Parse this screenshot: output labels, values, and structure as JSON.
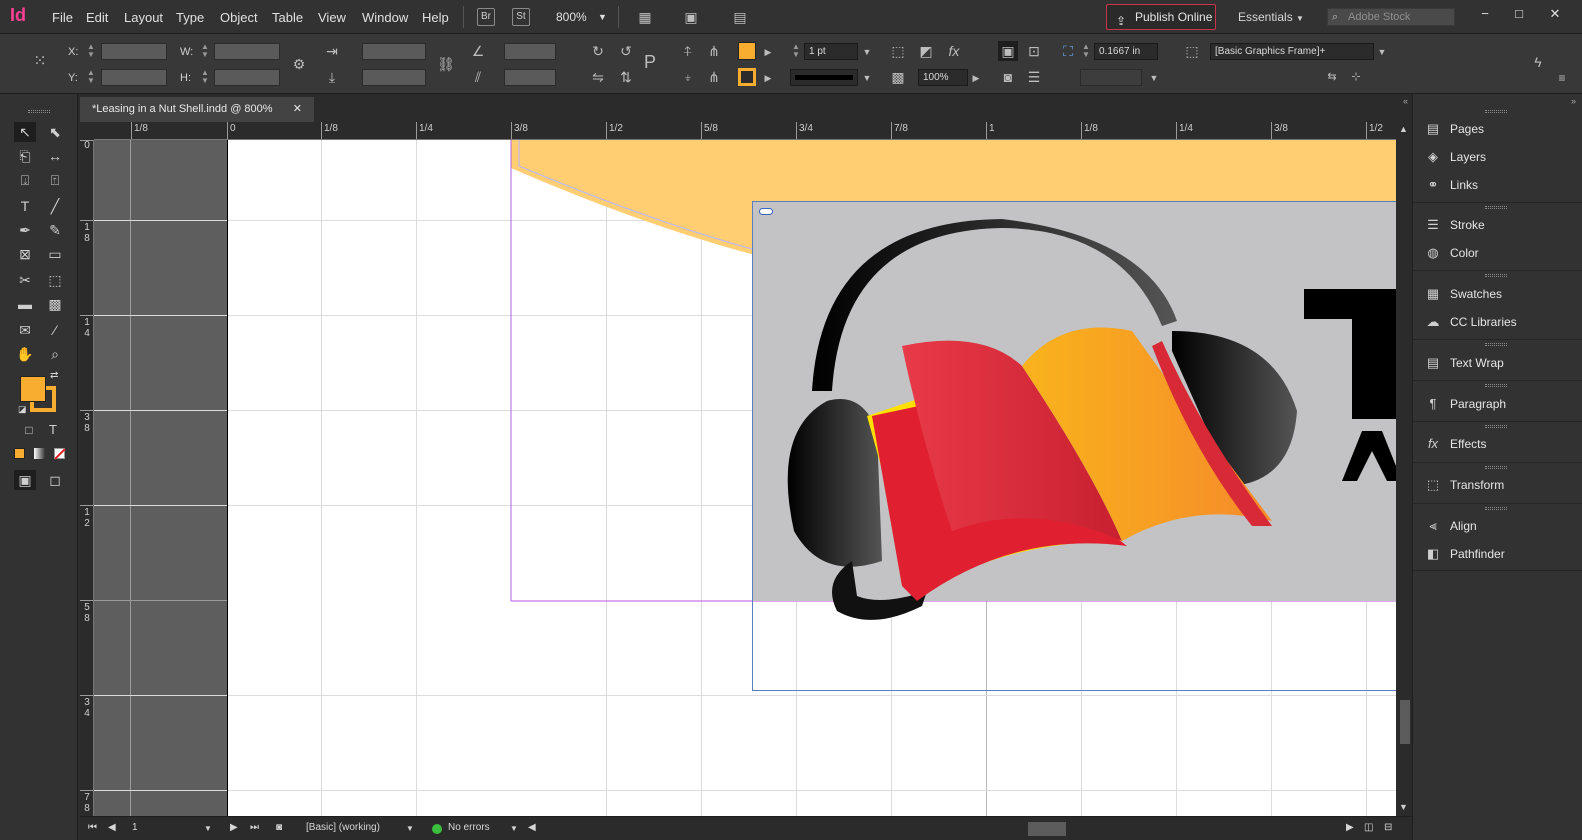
{
  "app": {
    "logo": "Id"
  },
  "menubar": {
    "items": [
      "File",
      "Edit",
      "Layout",
      "Type",
      "Object",
      "Table",
      "View",
      "Window",
      "Help"
    ],
    "bridge": "Br",
    "stock": "St",
    "zoom": "800%",
    "publish": "Publish Online",
    "workspace": "Essentials",
    "search_placeholder": "Adobe Stock"
  },
  "control": {
    "x_label": "X:",
    "y_label": "Y:",
    "w_label": "W:",
    "h_label": "H:",
    "stroke_weight": "1 pt",
    "opacity": "100%",
    "dimension": "0.1667 in",
    "object_style": "[Basic Graphics Frame]+"
  },
  "tab": {
    "title": "*Leasing in a Nut Shell.indd @ 800%"
  },
  "hruler": [
    "1/8",
    "0",
    "1/8",
    "1/4",
    "3/8",
    "1/2",
    "5/8",
    "3/4",
    "7/8",
    "1",
    "1/8",
    "1/4",
    "3/8",
    "1/2"
  ],
  "vruler": [
    [
      "0"
    ],
    [
      "1",
      "8"
    ],
    [
      "1",
      "4"
    ],
    [
      "3",
      "8"
    ],
    [
      "1",
      "2"
    ],
    [
      "5",
      "8"
    ],
    [
      "3",
      "4"
    ],
    [
      "7",
      "8"
    ]
  ],
  "status": {
    "page": "1",
    "style": "[Basic] (working)",
    "preflight": "No errors"
  },
  "panels": [
    "Pages",
    "Layers",
    "Links",
    "Stroke",
    "Color",
    "Swatches",
    "CC Libraries",
    "Text Wrap",
    "Paragraph",
    "Effects",
    "Transform",
    "Align",
    "Pathfinder"
  ],
  "colors": {
    "fill": "#f8ac30",
    "frame_bg": "#c3c3c5",
    "banner": "#ffcd72",
    "margin": "#b060e0"
  }
}
